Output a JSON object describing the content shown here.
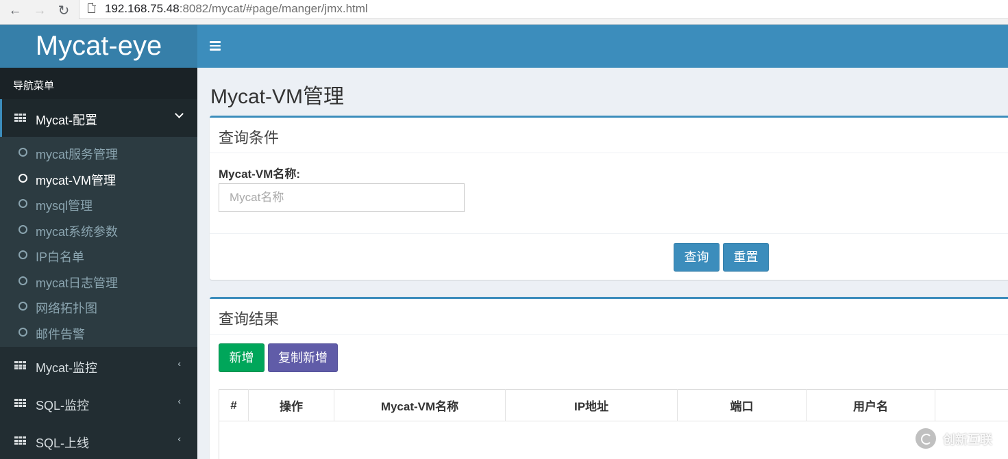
{
  "browser": {
    "url_host": "192.168.75.48",
    "url_rest": ":8082/mycat/#page/manger/jmx.html"
  },
  "app": {
    "logo": "Mycat-eye"
  },
  "sidebar": {
    "header": "导航菜单",
    "groups": [
      {
        "label": "Mycat-配置",
        "expanded": true,
        "items": [
          {
            "label": "mycat服务管理"
          },
          {
            "label": "mycat-VM管理",
            "current": true
          },
          {
            "label": "mysql管理"
          },
          {
            "label": "mycat系统参数"
          },
          {
            "label": "IP白名单"
          },
          {
            "label": "mycat日志管理"
          },
          {
            "label": "网络拓扑图"
          },
          {
            "label": "邮件告警"
          }
        ]
      },
      {
        "label": "Mycat-监控"
      },
      {
        "label": "SQL-监控"
      },
      {
        "label": "SQL-上线"
      }
    ]
  },
  "main": {
    "page_title": "Mycat-VM管理",
    "query_box": {
      "title": "查询条件",
      "field_label": "Mycat-VM名称:",
      "field_placeholder": "Mycat名称",
      "query_button": "查询",
      "reset_button": "重置"
    },
    "result_box": {
      "title": "查询结果",
      "add_button": "新增",
      "copy_add_button": "复制新增",
      "columns": [
        "#",
        "操作",
        "Mycat-VM名称",
        "IP地址",
        "端口",
        "用户名",
        ""
      ]
    }
  },
  "watermark": "创新互联",
  "colors": {
    "header": "#3c8dbc",
    "logo_bg": "#367fa9",
    "sidebar": "#222d32",
    "submenu": "#2c3b41",
    "success": "#00a65a",
    "purple": "#605ca8"
  }
}
